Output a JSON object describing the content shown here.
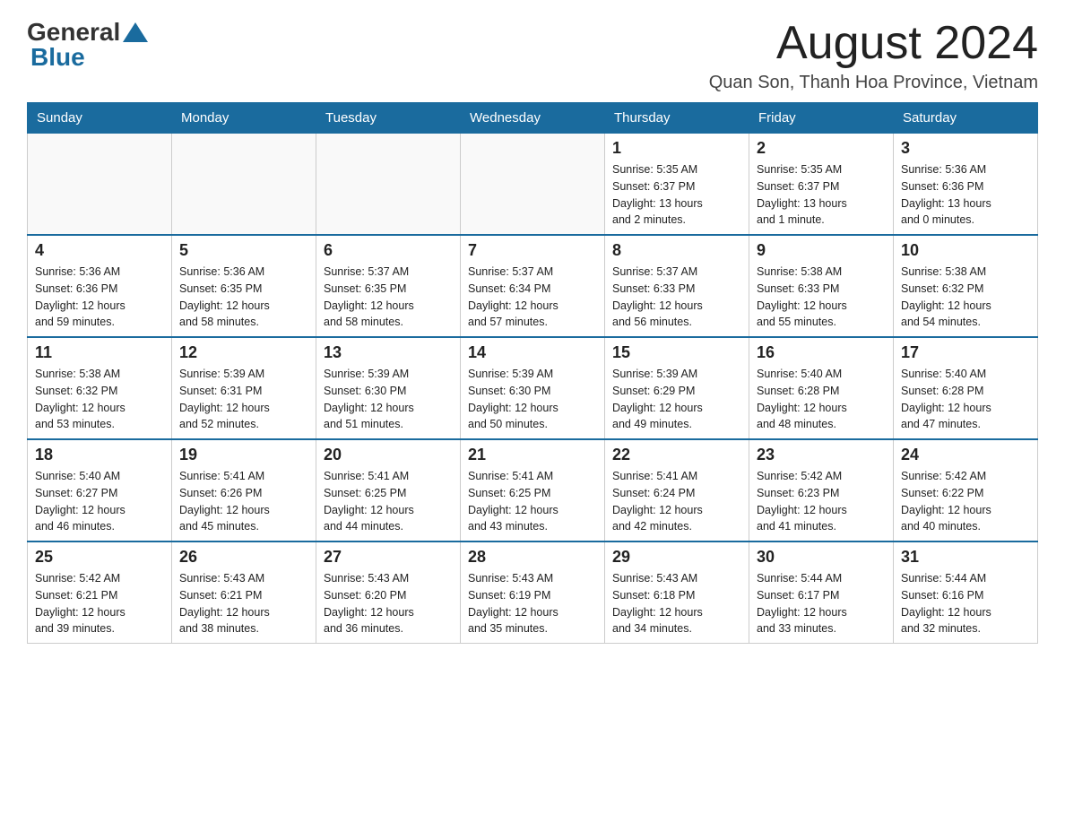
{
  "logo": {
    "general": "General",
    "blue": "Blue"
  },
  "header": {
    "month_title": "August 2024",
    "location": "Quan Son, Thanh Hoa Province, Vietnam"
  },
  "weekdays": [
    "Sunday",
    "Monday",
    "Tuesday",
    "Wednesday",
    "Thursday",
    "Friday",
    "Saturday"
  ],
  "weeks": [
    [
      {
        "day": "",
        "info": ""
      },
      {
        "day": "",
        "info": ""
      },
      {
        "day": "",
        "info": ""
      },
      {
        "day": "",
        "info": ""
      },
      {
        "day": "1",
        "info": "Sunrise: 5:35 AM\nSunset: 6:37 PM\nDaylight: 13 hours\nand 2 minutes."
      },
      {
        "day": "2",
        "info": "Sunrise: 5:35 AM\nSunset: 6:37 PM\nDaylight: 13 hours\nand 1 minute."
      },
      {
        "day": "3",
        "info": "Sunrise: 5:36 AM\nSunset: 6:36 PM\nDaylight: 13 hours\nand 0 minutes."
      }
    ],
    [
      {
        "day": "4",
        "info": "Sunrise: 5:36 AM\nSunset: 6:36 PM\nDaylight: 12 hours\nand 59 minutes."
      },
      {
        "day": "5",
        "info": "Sunrise: 5:36 AM\nSunset: 6:35 PM\nDaylight: 12 hours\nand 58 minutes."
      },
      {
        "day": "6",
        "info": "Sunrise: 5:37 AM\nSunset: 6:35 PM\nDaylight: 12 hours\nand 58 minutes."
      },
      {
        "day": "7",
        "info": "Sunrise: 5:37 AM\nSunset: 6:34 PM\nDaylight: 12 hours\nand 57 minutes."
      },
      {
        "day": "8",
        "info": "Sunrise: 5:37 AM\nSunset: 6:33 PM\nDaylight: 12 hours\nand 56 minutes."
      },
      {
        "day": "9",
        "info": "Sunrise: 5:38 AM\nSunset: 6:33 PM\nDaylight: 12 hours\nand 55 minutes."
      },
      {
        "day": "10",
        "info": "Sunrise: 5:38 AM\nSunset: 6:32 PM\nDaylight: 12 hours\nand 54 minutes."
      }
    ],
    [
      {
        "day": "11",
        "info": "Sunrise: 5:38 AM\nSunset: 6:32 PM\nDaylight: 12 hours\nand 53 minutes."
      },
      {
        "day": "12",
        "info": "Sunrise: 5:39 AM\nSunset: 6:31 PM\nDaylight: 12 hours\nand 52 minutes."
      },
      {
        "day": "13",
        "info": "Sunrise: 5:39 AM\nSunset: 6:30 PM\nDaylight: 12 hours\nand 51 minutes."
      },
      {
        "day": "14",
        "info": "Sunrise: 5:39 AM\nSunset: 6:30 PM\nDaylight: 12 hours\nand 50 minutes."
      },
      {
        "day": "15",
        "info": "Sunrise: 5:39 AM\nSunset: 6:29 PM\nDaylight: 12 hours\nand 49 minutes."
      },
      {
        "day": "16",
        "info": "Sunrise: 5:40 AM\nSunset: 6:28 PM\nDaylight: 12 hours\nand 48 minutes."
      },
      {
        "day": "17",
        "info": "Sunrise: 5:40 AM\nSunset: 6:28 PM\nDaylight: 12 hours\nand 47 minutes."
      }
    ],
    [
      {
        "day": "18",
        "info": "Sunrise: 5:40 AM\nSunset: 6:27 PM\nDaylight: 12 hours\nand 46 minutes."
      },
      {
        "day": "19",
        "info": "Sunrise: 5:41 AM\nSunset: 6:26 PM\nDaylight: 12 hours\nand 45 minutes."
      },
      {
        "day": "20",
        "info": "Sunrise: 5:41 AM\nSunset: 6:25 PM\nDaylight: 12 hours\nand 44 minutes."
      },
      {
        "day": "21",
        "info": "Sunrise: 5:41 AM\nSunset: 6:25 PM\nDaylight: 12 hours\nand 43 minutes."
      },
      {
        "day": "22",
        "info": "Sunrise: 5:41 AM\nSunset: 6:24 PM\nDaylight: 12 hours\nand 42 minutes."
      },
      {
        "day": "23",
        "info": "Sunrise: 5:42 AM\nSunset: 6:23 PM\nDaylight: 12 hours\nand 41 minutes."
      },
      {
        "day": "24",
        "info": "Sunrise: 5:42 AM\nSunset: 6:22 PM\nDaylight: 12 hours\nand 40 minutes."
      }
    ],
    [
      {
        "day": "25",
        "info": "Sunrise: 5:42 AM\nSunset: 6:21 PM\nDaylight: 12 hours\nand 39 minutes."
      },
      {
        "day": "26",
        "info": "Sunrise: 5:43 AM\nSunset: 6:21 PM\nDaylight: 12 hours\nand 38 minutes."
      },
      {
        "day": "27",
        "info": "Sunrise: 5:43 AM\nSunset: 6:20 PM\nDaylight: 12 hours\nand 36 minutes."
      },
      {
        "day": "28",
        "info": "Sunrise: 5:43 AM\nSunset: 6:19 PM\nDaylight: 12 hours\nand 35 minutes."
      },
      {
        "day": "29",
        "info": "Sunrise: 5:43 AM\nSunset: 6:18 PM\nDaylight: 12 hours\nand 34 minutes."
      },
      {
        "day": "30",
        "info": "Sunrise: 5:44 AM\nSunset: 6:17 PM\nDaylight: 12 hours\nand 33 minutes."
      },
      {
        "day": "31",
        "info": "Sunrise: 5:44 AM\nSunset: 6:16 PM\nDaylight: 12 hours\nand 32 minutes."
      }
    ]
  ]
}
